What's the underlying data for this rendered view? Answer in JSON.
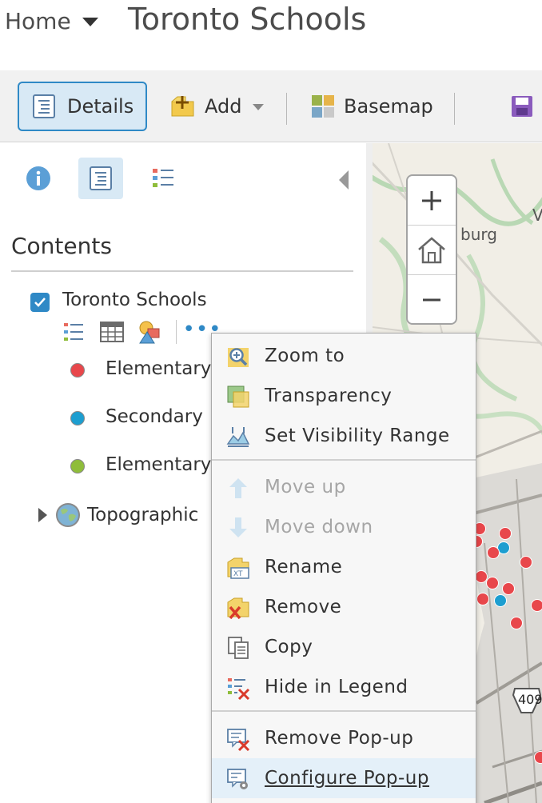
{
  "header": {
    "home_label": "Home",
    "title": "Toronto Schools"
  },
  "toolbar": {
    "details_label": "Details",
    "add_label": "Add",
    "basemap_label": "Basemap"
  },
  "panel": {
    "contents_title": "Contents",
    "layer": {
      "name": "Toronto Schools",
      "checked": true
    },
    "legend": [
      {
        "label": "Elementary",
        "color": "#e8474b"
      },
      {
        "label": "Secondary",
        "color": "#1d9ed0"
      },
      {
        "label": "Elementary",
        "color": "#8fbd3b"
      }
    ],
    "basemap_label": "Topographic"
  },
  "map": {
    "label_partial": "burg",
    "label_v": "V",
    "highway_label": "409"
  },
  "context_menu": {
    "items": [
      {
        "label": "Zoom to",
        "icon": "zoom-to-icon",
        "enabled": true
      },
      {
        "label": "Transparency",
        "icon": "transparency-icon",
        "enabled": true
      },
      {
        "label": "Set Visibility Range",
        "icon": "visibility-range-icon",
        "enabled": true
      },
      {
        "label": "Move up",
        "icon": "arrow-up-icon",
        "enabled": false
      },
      {
        "label": "Move down",
        "icon": "arrow-down-icon",
        "enabled": false
      },
      {
        "label": "Rename",
        "icon": "rename-icon",
        "enabled": true
      },
      {
        "label": "Remove",
        "icon": "remove-icon",
        "enabled": true
      },
      {
        "label": "Copy",
        "icon": "copy-icon",
        "enabled": true
      },
      {
        "label": "Hide in Legend",
        "icon": "hide-legend-icon",
        "enabled": true
      },
      {
        "label": "Remove Pop-up",
        "icon": "remove-popup-icon",
        "enabled": true
      },
      {
        "label": "Configure Pop-up",
        "icon": "configure-popup-icon",
        "enabled": true,
        "hovered": true
      }
    ]
  },
  "colors": {
    "accent": "#2f89c6",
    "school_elementary": "#e8474b",
    "school_secondary": "#1d9ed0"
  }
}
